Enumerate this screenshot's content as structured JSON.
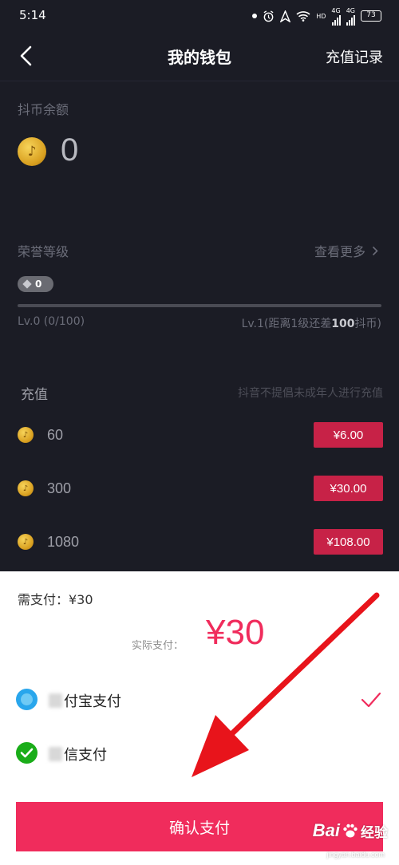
{
  "status_bar": {
    "time": "5:14",
    "net_label": "HD",
    "net_type_1": "4G",
    "net_type_2": "4G",
    "battery": "73",
    "icons": [
      "notification-dot-icon",
      "alarm-icon",
      "navigation-icon",
      "wifi-icon",
      "signal-icon",
      "battery-icon"
    ]
  },
  "nav": {
    "back_icon": "chevron-left-icon",
    "title": "我的钱包",
    "history_link": "充值记录"
  },
  "balance": {
    "label": "抖币余额",
    "value": "0",
    "coin_glyph": "♪"
  },
  "honor": {
    "label": "荣誉等级",
    "see_more": "查看更多",
    "level_badge": "0",
    "progress_fraction": 0.0,
    "left_caption": "Lv.0 (0/100)",
    "right_caption_prefix": "Lv.1(距离1级还差",
    "right_caption_value": "100",
    "right_caption_suffix": "抖币)"
  },
  "recharge": {
    "title": "充值",
    "notice": "抖音不提倡未成年人进行充值",
    "packages": [
      {
        "amount": "60",
        "price": "¥6.00"
      },
      {
        "amount": "300",
        "price": "¥30.00"
      },
      {
        "amount": "1080",
        "price": "¥108.00"
      }
    ]
  },
  "payment_sheet": {
    "need_pay": "需支付：¥30",
    "actual_label": "实际支付：",
    "actual_amount": "¥30",
    "methods": [
      {
        "label": "付宝支付",
        "icon": "alipay-icon",
        "selected": true
      },
      {
        "label": "信支付",
        "icon": "wechat-icon",
        "selected": false
      }
    ],
    "confirm_label": "确认支付"
  },
  "watermark": {
    "brand": "Bai",
    "brand_suffix": "经验",
    "url": "jingyan.baidu.com"
  },
  "colors": {
    "background": "#1b1c25",
    "accent": "#f02c5c",
    "price_button": "#c72247",
    "annotation_arrow": "#e8141b"
  }
}
